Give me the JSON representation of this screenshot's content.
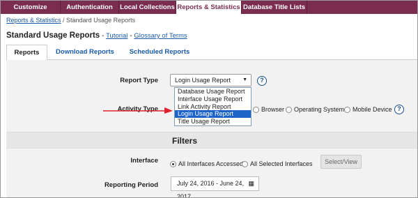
{
  "topnav": {
    "items": [
      {
        "label": "Customize Services"
      },
      {
        "label": "Authentication"
      },
      {
        "label": "Local Collections"
      },
      {
        "label": "Reports & Statistics"
      },
      {
        "label": "Database Title Lists"
      }
    ],
    "active_index": 3
  },
  "breadcrumb": {
    "link": "Reports & Statistics",
    "separator": " / ",
    "current": "Standard Usage Reports"
  },
  "page": {
    "title": "Standard Usage Reports",
    "dash": " - ",
    "tutorial_link": "Tutorial",
    "glossary_link": "Glossary of Terms"
  },
  "tabs": [
    {
      "label": "Reports"
    },
    {
      "label": "Download Reports"
    },
    {
      "label": "Scheduled Reports"
    }
  ],
  "report_type": {
    "label": "Report Type",
    "selected": "Login Usage Report",
    "help": "?",
    "options": [
      "Database Usage Report",
      "Interface Usage Report",
      "Link Activity Report",
      "Login Usage Report",
      "Title Usage Report"
    ],
    "highlighted_index": 3
  },
  "activity_type": {
    "label": "Activity Type",
    "options": [
      "Browser",
      "Operating System",
      "Mobile Device"
    ],
    "help": "?"
  },
  "filters": {
    "heading": "Filters"
  },
  "interface": {
    "label": "Interface",
    "options": [
      "All Interfaces Accessed",
      "All Selected Interfaces"
    ],
    "selected_index": 0,
    "button": "Select/View"
  },
  "reporting_period": {
    "label": "Reporting Period",
    "value": "July 24, 2016 - June 24, 2017"
  },
  "colors": {
    "nav_bg": "#7b2d4f",
    "link": "#1a5aa8",
    "highlight": "#1e64c8",
    "arrow": "#e0202a"
  },
  "icons": {
    "calendar": "calendar-icon",
    "help": "help-icon",
    "caret": "caret-down-icon"
  }
}
